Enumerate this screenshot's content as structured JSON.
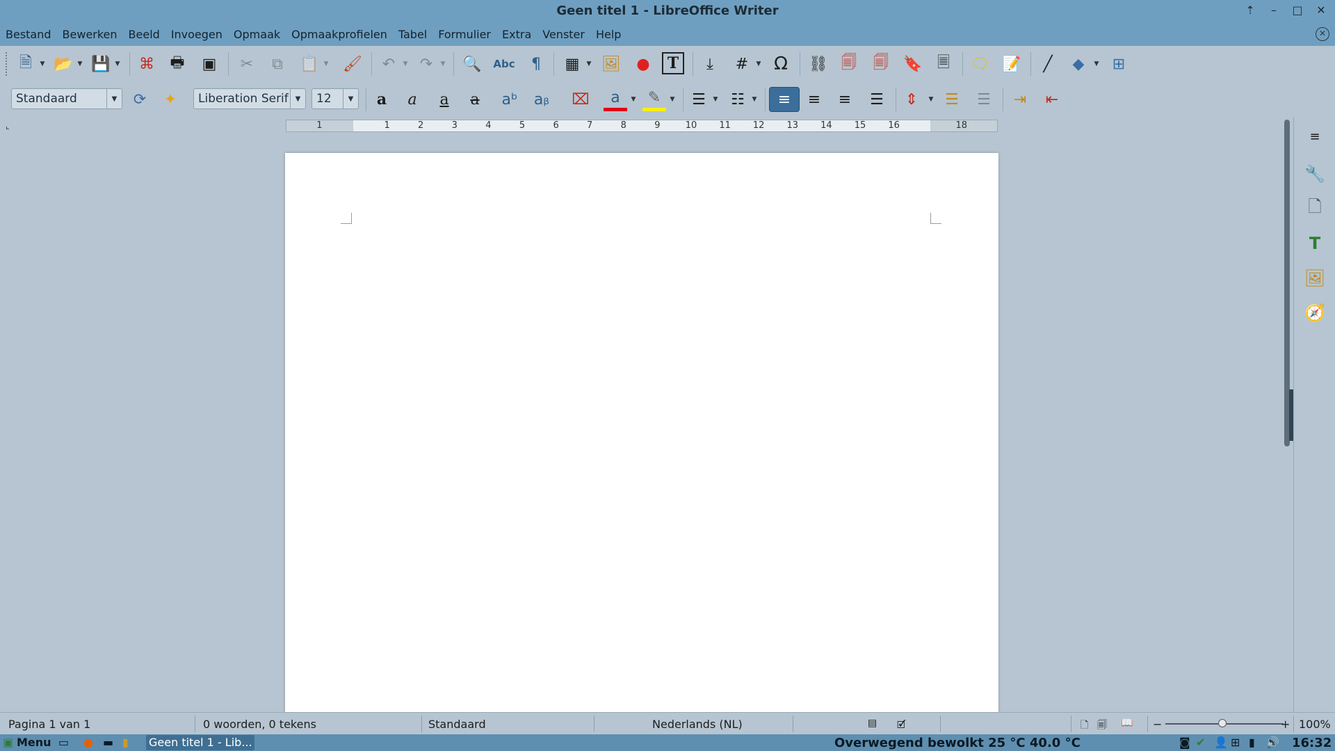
{
  "window": {
    "title": "Geen titel 1 - LibreOffice Writer"
  },
  "menubar": {
    "items": [
      "Bestand",
      "Bewerken",
      "Beeld",
      "Invoegen",
      "Opmaak",
      "Opmaakprofielen",
      "Tabel",
      "Formulier",
      "Extra",
      "Venster",
      "Help"
    ]
  },
  "formatting": {
    "paragraph_style": "Standaard",
    "font_name": "Liberation Serif",
    "font_size": "12"
  },
  "ruler": {
    "left_numbers": [
      "1"
    ],
    "numbers": [
      "1",
      "2",
      "3",
      "4",
      "5",
      "6",
      "7",
      "8",
      "9",
      "10",
      "11",
      "12",
      "13",
      "14",
      "15",
      "16",
      "18"
    ]
  },
  "statusbar": {
    "page": "Pagina 1 van 1",
    "words": "0 woorden, 0 tekens",
    "page_style": "Standaard",
    "language": "Nederlands (NL)",
    "zoom": "100%"
  },
  "taskbar": {
    "menu_label": "Menu",
    "window_label": "Geen titel 1 - Lib...",
    "weather": "Overwegend bewolkt 25 °C 40.0 °C",
    "clock": "16:32"
  },
  "colors": {
    "titlebar": "#6f9fc0",
    "workspace": "#b6c5d1",
    "font_color_bar": "#e0001a",
    "highlight_bar": "#ffef00",
    "active_align": "#3b6e9a"
  }
}
